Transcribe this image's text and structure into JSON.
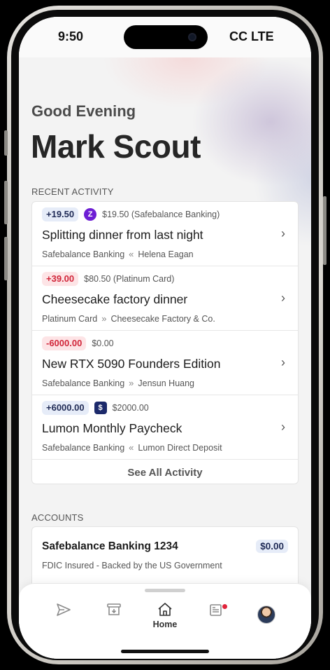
{
  "status_bar": {
    "time": "9:50",
    "carrier": "CC LTE"
  },
  "header": {
    "greeting": "Good Evening",
    "user_name": "Mark Scout"
  },
  "recent_activity": {
    "label": "RECENT ACTIVITY",
    "items": [
      {
        "amount": "+19.50",
        "type": "pos",
        "source_icon": "zelle-icon",
        "note": "$19.50 (Safebalance Banking)",
        "title": "Splitting dinner from last night",
        "from": "Safebalance Banking",
        "direction": "«",
        "to": "Helena Eagan"
      },
      {
        "amount": "+39.00",
        "type": "neg",
        "source_icon": "",
        "note": "$80.50 (Platinum Card)",
        "title": "Cheesecake factory dinner",
        "from": "Platinum Card",
        "direction": "»",
        "to": "Cheesecake Factory & Co."
      },
      {
        "amount": "-6000.00",
        "type": "neg",
        "source_icon": "",
        "note": "$0.00",
        "title": "New RTX 5090 Founders Edition",
        "from": "Safebalance Banking",
        "direction": "»",
        "to": "Jensun Huang"
      },
      {
        "amount": "+6000.00",
        "type": "pos",
        "source_icon": "bank-icon",
        "note": "$2000.00",
        "title": "Lumon Monthly Paycheck",
        "from": "Safebalance Banking",
        "direction": "«",
        "to": "Lumon Direct Deposit"
      }
    ],
    "see_all": "See All Activity"
  },
  "accounts": {
    "label": "ACCOUNTS",
    "items": [
      {
        "name": "Safebalance Banking 1234",
        "subtitle": "FDIC Insured - Backed by the US Government",
        "balance": "$0.00"
      }
    ]
  },
  "tab_bar": {
    "tabs": [
      {
        "name": "send",
        "icon": "send-icon",
        "label": ""
      },
      {
        "name": "deposit",
        "icon": "inbox-download-icon",
        "label": ""
      },
      {
        "name": "home",
        "icon": "home-icon",
        "label": "Home"
      },
      {
        "name": "news",
        "icon": "newspaper-icon",
        "label": ""
      },
      {
        "name": "profile",
        "icon": "avatar",
        "label": ""
      }
    ]
  },
  "colors": {
    "positive_pill_bg": "#e6ecf8",
    "negative_pill_bg": "#fde4e6",
    "negative_text": "#d1263a",
    "zelle": "#6d1ed4"
  }
}
